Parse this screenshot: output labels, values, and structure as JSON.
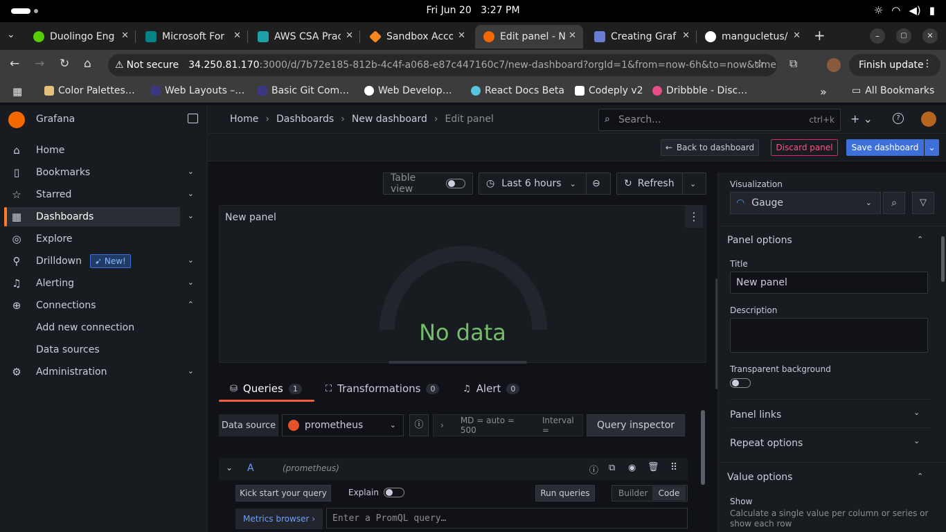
{
  "os": {
    "date": "Fri Jun 20",
    "time": "3:27 PM"
  },
  "tabs": [
    {
      "title": "Duolingo Eng",
      "color": "#58cc02"
    },
    {
      "title": "Microsoft For",
      "color": "#038387"
    },
    {
      "title": "AWS CSA Prac",
      "color": "#1ea0a8"
    },
    {
      "title": "Sandbox Acco",
      "color": "#f5871f"
    },
    {
      "title": "Edit panel - N",
      "color": "#f46800"
    },
    {
      "title": "Creating Graf",
      "color": "#6c7bd6"
    },
    {
      "title": "mangucletus/",
      "color": "#ffffff"
    }
  ],
  "address": {
    "security": "Not secure",
    "host": "34.250.81.170",
    "path": ":3000/d/7b72e185-812b-4c4f-a068-e87c447160c7/new-dashboard?orgId=1&from=now-6h&to=now&timezone=…",
    "finish_update": "Finish update"
  },
  "bookmarks": [
    {
      "label": "Color Palettes…",
      "color": "#e5c07b"
    },
    {
      "label": "Web Layouts –…",
      "color": "#2e2b5f"
    },
    {
      "label": "Basic Git Com…",
      "color": "#2e2b5f"
    },
    {
      "label": "Web Develop…",
      "color": "#ffffff"
    },
    {
      "label": "React Docs Beta",
      "color": "#58c4dc"
    },
    {
      "label": "Codeply v2",
      "color": "#ffffff"
    },
    {
      "label": "Dribbble - Disc…",
      "color": "#ea4c89"
    }
  ],
  "all_bookmarks": "All Bookmarks",
  "grafana": {
    "brand": "Grafana",
    "nav": [
      {
        "label": "Home",
        "icon": "home-icon",
        "glyph": "⌂"
      },
      {
        "label": "Bookmarks",
        "icon": "bookmark-icon",
        "glyph": "▯"
      },
      {
        "label": "Starred",
        "icon": "star-icon",
        "glyph": "☆"
      },
      {
        "label": "Dashboards",
        "icon": "grid-icon",
        "glyph": "▦"
      },
      {
        "label": "Explore",
        "icon": "compass-icon",
        "glyph": "◎"
      },
      {
        "label": "Drilldown",
        "icon": "drill-icon",
        "glyph": "⚲"
      },
      {
        "label": "Alerting",
        "icon": "bell-icon",
        "glyph": "♫"
      },
      {
        "label": "Connections",
        "icon": "connections-icon",
        "glyph": "⊕"
      },
      {
        "label": "Administration",
        "icon": "gear-icon",
        "glyph": "⚙"
      }
    ],
    "new_badge": "New!",
    "sub_items": [
      "Add new connection",
      "Data sources"
    ],
    "breadcrumb": [
      "Home",
      "Dashboards",
      "New dashboard",
      "Edit panel"
    ],
    "search_placeholder": "Search...",
    "search_shortcut": "ctrl+k"
  },
  "toolbar": {
    "back": "Back to dashboard",
    "discard": "Discard panel",
    "save": "Save dashboard"
  },
  "controls": {
    "table_view": "Table view",
    "time_range": "Last 6 hours",
    "refresh": "Refresh"
  },
  "panel": {
    "title": "New panel",
    "no_data": "No data"
  },
  "query_tabs": [
    {
      "label": "Queries",
      "count": "1"
    },
    {
      "label": "Transformations",
      "count": "0"
    },
    {
      "label": "Alert",
      "count": "0"
    }
  ],
  "query": {
    "data_source_label": "Data source",
    "data_source": "prometheus",
    "md": "MD = auto = 500",
    "interval": "Interval =",
    "inspector": "Query inspector",
    "ref": "A",
    "ds_hint": "(prometheus)",
    "kick_start": "Kick start your query",
    "explain": "Explain",
    "run": "Run queries",
    "builder": "Builder",
    "code": "Code",
    "metrics_browser": "Metrics browser ›",
    "promql_placeholder": "Enter a PromQL query…"
  },
  "options": {
    "visualization_label": "Visualization",
    "visualization": "Gauge",
    "panel_options": "Panel options",
    "title_label": "Title",
    "title_value": "New panel",
    "description_label": "Description",
    "transparent_label": "Transparent background",
    "panel_links": "Panel links",
    "repeat_options": "Repeat options",
    "value_options": "Value options",
    "show_label": "Show",
    "show_desc": "Calculate a single value per column or series or show each row"
  }
}
